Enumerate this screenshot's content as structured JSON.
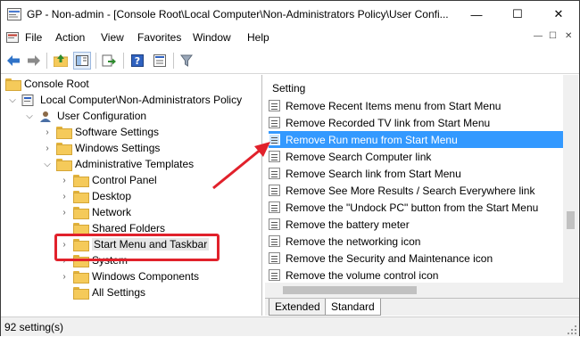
{
  "window": {
    "title": "GP - Non-admin - [Console Root\\Local Computer\\Non-Administrators Policy\\User Confi...",
    "minimize": "—",
    "maximize": "☐",
    "close": "✕"
  },
  "menubar": {
    "items": [
      "File",
      "Action",
      "View",
      "Favorites",
      "Window",
      "Help"
    ],
    "mdi_controls": [
      "—",
      "☐",
      "✕"
    ]
  },
  "toolbar": {
    "buttons": [
      "back-icon",
      "forward-icon",
      "up-folder-icon",
      "show-hide-tree-icon",
      "export-list-icon",
      "help-icon",
      "properties-icon",
      "filter-icon"
    ]
  },
  "tree": {
    "root": "Console Root",
    "local_computer": "Local Computer\\Non-Administrators Policy",
    "user_config": "User Configuration",
    "software_settings": "Software Settings",
    "windows_settings": "Windows Settings",
    "admin_templates": "Administrative Templates",
    "control_panel": "Control Panel",
    "desktop": "Desktop",
    "network": "Network",
    "shared_folders": "Shared Folders",
    "start_menu": "Start Menu and Taskbar",
    "system": "System",
    "windows_components": "Windows Components",
    "all_settings": "All Settings"
  },
  "list": {
    "header": "Setting",
    "rows": [
      "Remove Recent Items menu from Start Menu",
      "Remove Recorded TV link from Start Menu",
      "Remove Run menu from Start Menu",
      "Remove Search Computer link",
      "Remove Search link from Start Menu",
      "Remove See More Results / Search Everywhere link",
      "Remove the \"Undock PC\" button from the Start Menu",
      "Remove the battery meter",
      "Remove the networking icon",
      "Remove the Security and Maintenance icon",
      "Remove the volume control icon"
    ],
    "selected_index": 2
  },
  "tabs": {
    "extended": "Extended",
    "standard": "Standard",
    "active": "Standard"
  },
  "status": {
    "text": "92 setting(s)"
  },
  "colors": {
    "selection": "#3399ff",
    "annotation": "#e1212b"
  }
}
